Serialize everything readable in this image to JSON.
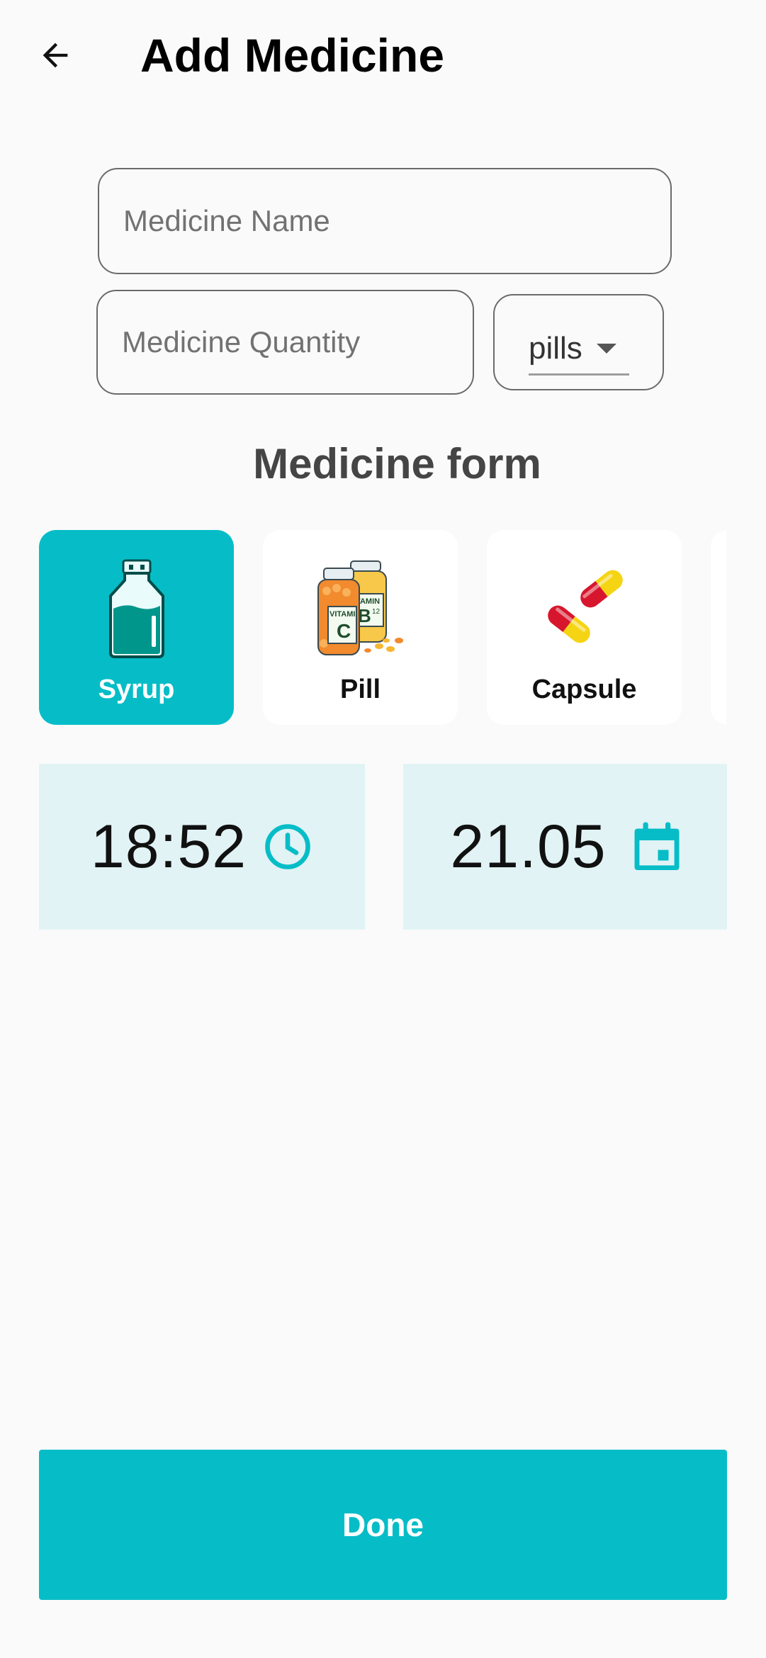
{
  "header": {
    "title": "Add Medicine",
    "back_icon": "arrow-left-icon"
  },
  "form": {
    "name": {
      "placeholder": "Medicine Name",
      "value": ""
    },
    "quantity": {
      "placeholder": "Medicine Quantity",
      "value": ""
    },
    "unit": {
      "selected": "pills"
    }
  },
  "medicine_form": {
    "heading": "Medicine form",
    "options": [
      {
        "label": "Syrup",
        "icon": "syrup-bottle-icon",
        "selected": true
      },
      {
        "label": "Pill",
        "icon": "vitamin-bottles-icon",
        "selected": false
      },
      {
        "label": "Capsule",
        "icon": "capsule-icon",
        "selected": false
      }
    ]
  },
  "schedule": {
    "time": "18:52",
    "time_icon": "clock-icon",
    "date": "21.05",
    "date_icon": "calendar-icon"
  },
  "actions": {
    "done_label": "Done"
  },
  "colors": {
    "accent": "#06bdc7",
    "accent_dark": "#009e97",
    "picker_bg": "#e1f3f5",
    "background": "#fafafa"
  }
}
